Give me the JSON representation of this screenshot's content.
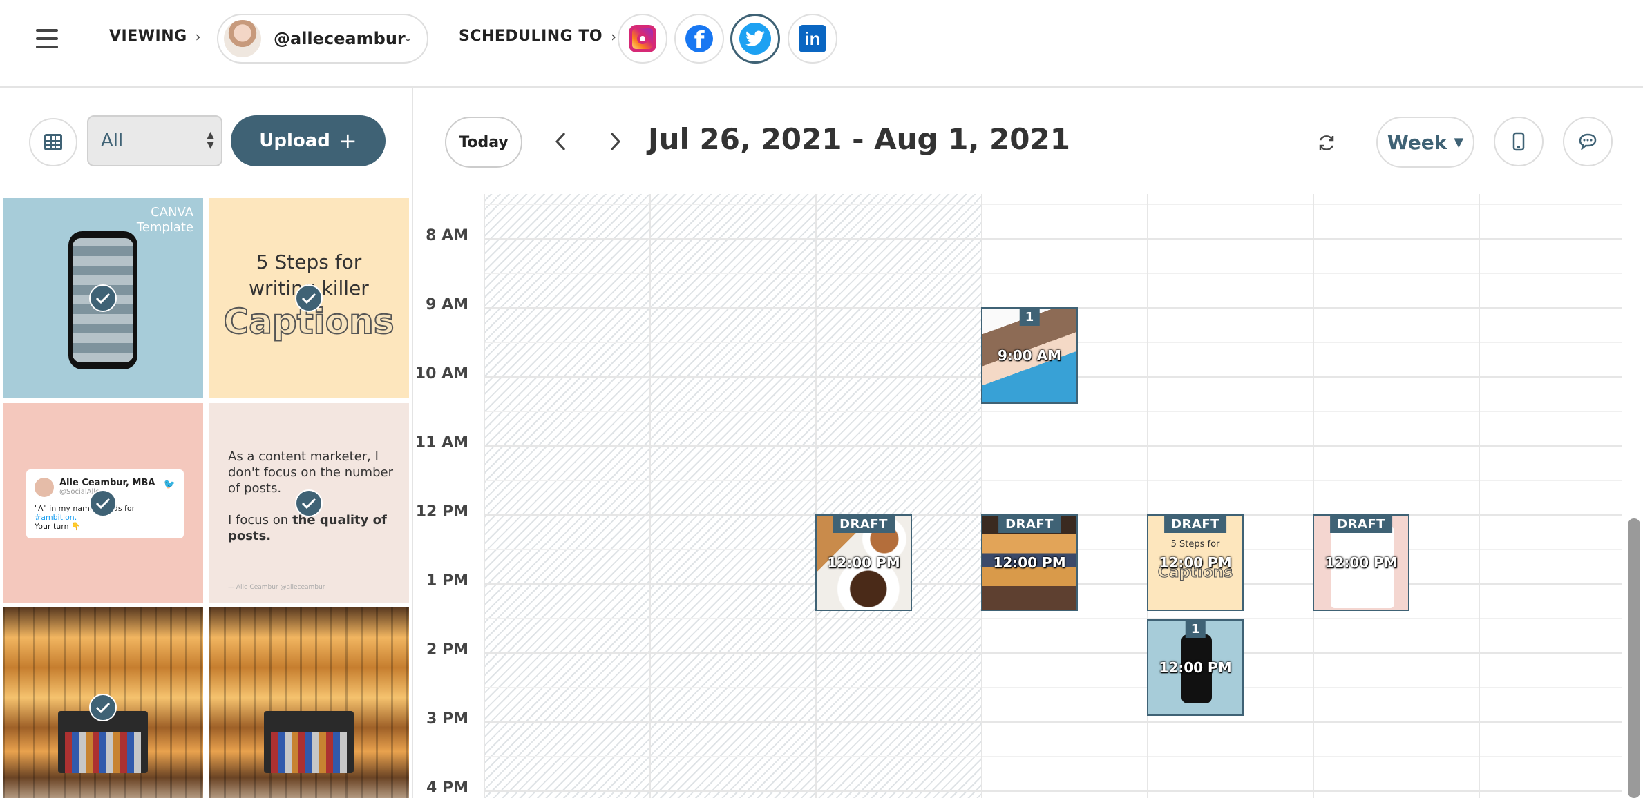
{
  "topbar": {
    "viewing_label": "VIEWING",
    "account_handle": "@alleceambur",
    "scheduling_label": "SCHEDULING TO",
    "networks": [
      {
        "name": "Instagram",
        "icon": "instagram-icon",
        "active": false
      },
      {
        "name": "Facebook",
        "icon": "facebook-icon",
        "active": false
      },
      {
        "name": "Twitter",
        "icon": "twitter-icon",
        "active": true
      },
      {
        "name": "LinkedIn",
        "icon": "linkedin-icon",
        "active": false
      }
    ]
  },
  "library": {
    "filter_value": "All",
    "upload_label": "Upload",
    "tiles": {
      "t1": {
        "canva_line1": "CANVA",
        "canva_line2": "Template"
      },
      "t2": {
        "line1": "5 Steps for",
        "line2": "writing killer",
        "line3": "Captions"
      },
      "t3": {
        "name": "Alle Ceambur, MBA",
        "user": "@SocialAlle",
        "body": "\"A\" in my name stands for",
        "hashtag": "#ambition.",
        "body2": "Your turn 👇"
      },
      "t4": {
        "p1": "As a content marketer, I don't focus on the number of posts.",
        "p2_start": "I focus on",
        "p2_bold": "the quality of posts.",
        "sig": "— Alle Ceambur @alleceambur"
      }
    }
  },
  "calendar": {
    "today_label": "Today",
    "range": "Jul 26, 2021 - Aug 1, 2021",
    "view": "Week",
    "hours": [
      "8 AM",
      "9 AM",
      "10 AM",
      "11 AM",
      "12 PM",
      "1 PM",
      "2 PM",
      "3 PM",
      "4 PM"
    ],
    "posts": [
      {
        "id": "p1",
        "day": 3,
        "badge": "1",
        "time": "9:00 AM"
      },
      {
        "id": "p2",
        "day": 2,
        "badge": "DRAFT",
        "time": "12:00 PM"
      },
      {
        "id": "p3",
        "day": 3,
        "badge": "DRAFT",
        "time": "12:00 PM"
      },
      {
        "id": "p4",
        "day": 4,
        "badge": "DRAFT",
        "time": "12:00 PM",
        "mini": "5 Steps for",
        "big": "Captions"
      },
      {
        "id": "p5",
        "day": 5,
        "badge": "DRAFT",
        "time": "12:00 PM"
      },
      {
        "id": "p6",
        "day": 4,
        "badge": "1",
        "time": "12:00 PM"
      }
    ]
  }
}
